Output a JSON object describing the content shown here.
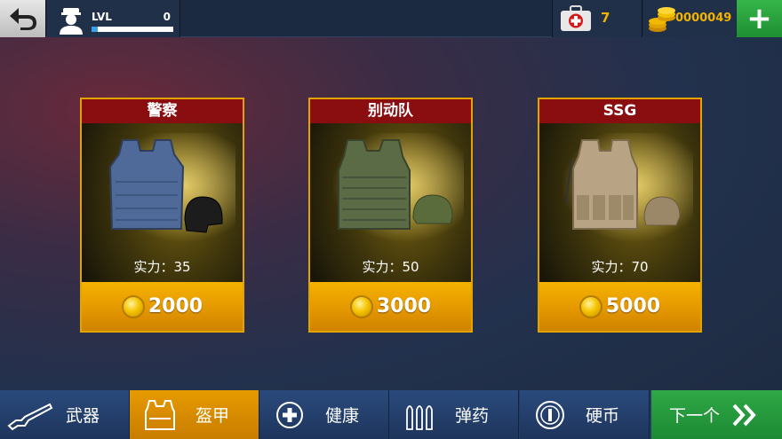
{
  "topbar": {
    "lvl_label": "LVL",
    "lvl_value": "0",
    "xp_progress": 0.08,
    "medkit_count": "7",
    "coins": "0000049",
    "add_label": "+"
  },
  "cards": [
    {
      "title": "警察",
      "power": "实力：35",
      "price": "2000",
      "vest_color": "#4f6a98",
      "helmet_color": "#1c1c1c"
    },
    {
      "title": "别动队",
      "power": "实力：50",
      "price": "3000",
      "vest_color": "#5b6b45",
      "helmet_color": "#5a6b3c"
    },
    {
      "title": "SSG",
      "power": "实力：70",
      "price": "5000",
      "vest_color": "#b8a484",
      "helmet_color": "#9a8868"
    }
  ],
  "bottom_nav": [
    {
      "label": "武器",
      "icon": "shotgun-icon",
      "active": false
    },
    {
      "label": "盔甲",
      "icon": "armor-vest-icon",
      "active": true
    },
    {
      "label": "健康",
      "icon": "health-plus-icon",
      "active": false
    },
    {
      "label": "弹药",
      "icon": "ammo-icon",
      "active": false
    },
    {
      "label": "硬币",
      "icon": "coin-icon",
      "active": false
    }
  ],
  "next_button": {
    "label": "下一个",
    "icon": "double-chevron-right-icon"
  },
  "colors": {
    "accent": "#e69a00",
    "title_bar": "#8a0d10",
    "go_green": "#1d8a33",
    "gold_text": "#f2b300"
  }
}
